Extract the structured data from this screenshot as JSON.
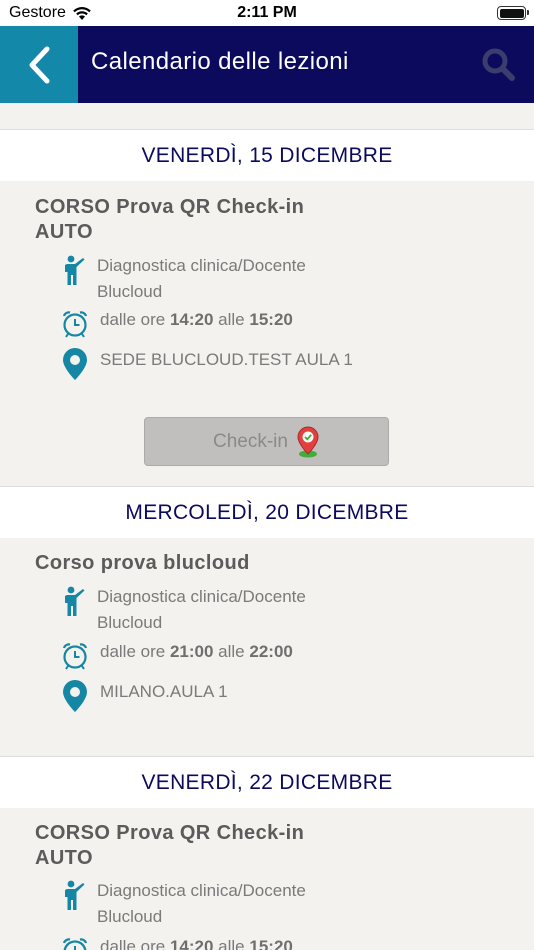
{
  "status_bar": {
    "carrier": "Gestore",
    "time": "2:11 PM"
  },
  "navbar": {
    "title": "Calendario delle lezioni"
  },
  "days": [
    {
      "date": "VENERDÌ, 15 DICEMBRE",
      "lesson": {
        "title": "CORSO Prova QR Check-in AUTO",
        "teacher_line1": "Diagnostica clinica/Docente",
        "teacher_line2": "Blucloud",
        "time_prefix": "dalle ore",
        "time_start": "14:20",
        "time_mid": "alle",
        "time_end": "15:20",
        "location": "SEDE BLUCLOUD.TEST AULA 1",
        "checkin_label": "Check-in"
      }
    },
    {
      "date": "MERCOLEDÌ, 20 DICEMBRE",
      "lesson": {
        "title": "Corso prova blucloud",
        "teacher_line1": "Diagnostica clinica/Docente",
        "teacher_line2": "Blucloud",
        "time_prefix": "dalle ore",
        "time_start": "21:00",
        "time_mid": "alle",
        "time_end": "22:00",
        "location": "MILANO.AULA 1"
      }
    },
    {
      "date": "VENERDÌ, 22 DICEMBRE",
      "lesson": {
        "title": "CORSO Prova QR Check-in AUTO",
        "teacher_line1": "Diagnostica clinica/Docente",
        "teacher_line2": "Blucloud",
        "time_prefix": "dalle ore",
        "time_start": "14:20",
        "time_mid": "alle",
        "time_end": "15:20"
      }
    }
  ],
  "icons": {
    "back": "chevron-left-icon",
    "search": "search-icon",
    "teacher": "teacher-icon",
    "clock": "alarm-clock-icon",
    "location": "location-pin-icon",
    "checkin": "checkin-pin-icon"
  },
  "colors": {
    "navbar_bg": "#0b0a5c",
    "back_bg": "#1388a8",
    "icon_teal": "#1586a4",
    "date_text": "#0b0a5c",
    "page_bg": "#f3f2ee"
  }
}
